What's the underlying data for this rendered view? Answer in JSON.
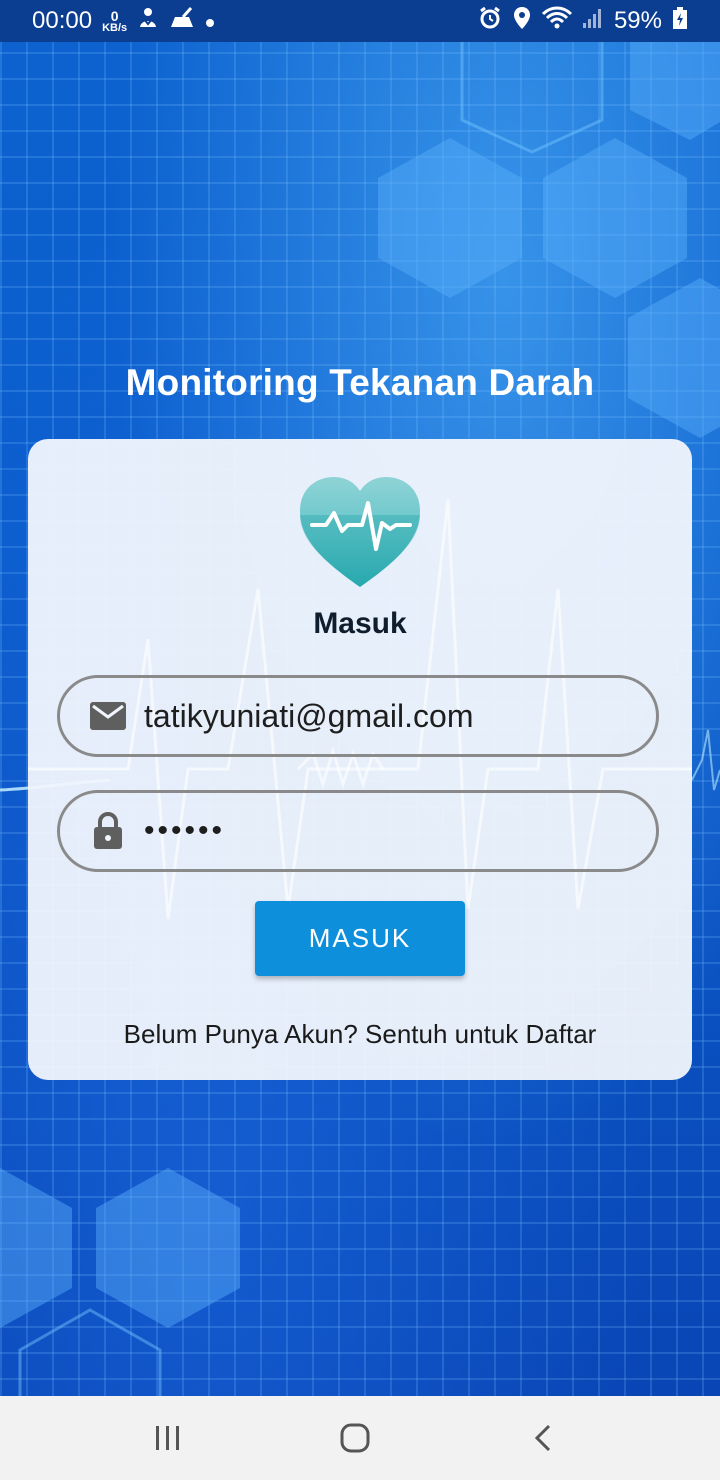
{
  "status_bar": {
    "time": "00:00",
    "net_speed_value": "0",
    "net_speed_unit": "KB/s",
    "battery": "59%"
  },
  "app": {
    "title": "Monitoring Tekanan Darah"
  },
  "login_card": {
    "heading": "Masuk",
    "email_value": "tatikyuniati@gmail.com",
    "password_value": "••••••",
    "submit_label": "MASUK",
    "register_text": "Belum Punya Akun? Sentuh untuk Daftar"
  },
  "icons": {
    "logo": "heart-pulse-icon",
    "email": "mail-icon",
    "password": "lock-icon"
  },
  "colors": {
    "primary_button": "#0d8fdc",
    "logo_teal": "#3fb8bb",
    "background_blue": "#0c5bc7"
  }
}
